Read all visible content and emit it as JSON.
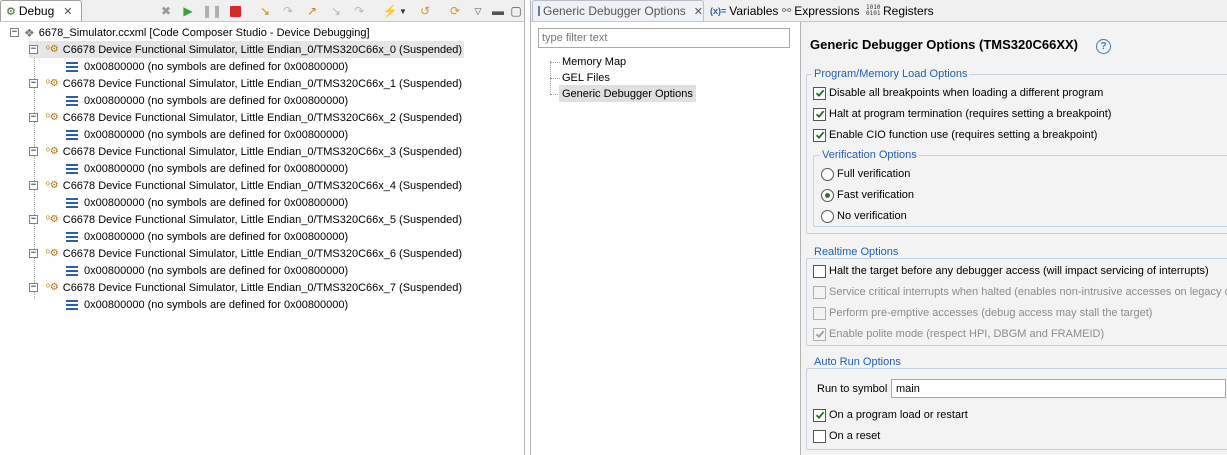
{
  "debug_view": {
    "tab_label": "Debug",
    "root_label": "6678_Simulator.ccxml [Code Composer Studio - Device Debugging]",
    "threads": [
      {
        "label": "C6678 Device Functional Simulator, Little Endian_0/TMS320C66x_0 (Suspended)",
        "frame": "0x00800000  (no symbols are defined for 0x00800000)"
      },
      {
        "label": "C6678 Device Functional Simulator, Little Endian_0/TMS320C66x_1 (Suspended)",
        "frame": "0x00800000  (no symbols are defined for 0x00800000)"
      },
      {
        "label": "C6678 Device Functional Simulator, Little Endian_0/TMS320C66x_2 (Suspended)",
        "frame": "0x00800000  (no symbols are defined for 0x00800000)"
      },
      {
        "label": "C6678 Device Functional Simulator, Little Endian_0/TMS320C66x_3 (Suspended)",
        "frame": "0x00800000  (no symbols are defined for 0x00800000)"
      },
      {
        "label": "C6678 Device Functional Simulator, Little Endian_0/TMS320C66x_4 (Suspended)",
        "frame": "0x00800000  (no symbols are defined for 0x00800000)"
      },
      {
        "label": "C6678 Device Functional Simulator, Little Endian_0/TMS320C66x_5 (Suspended)",
        "frame": "0x00800000  (no symbols are defined for 0x00800000)"
      },
      {
        "label": "C6678 Device Functional Simulator, Little Endian_0/TMS320C66x_6 (Suspended)",
        "frame": "0x00800000  (no symbols are defined for 0x00800000)"
      },
      {
        "label": "C6678 Device Functional Simulator, Little Endian_0/TMS320C66x_7 (Suspended)",
        "frame": "0x00800000  (no symbols are defined for 0x00800000)"
      }
    ]
  },
  "tabs": {
    "gdo": "Generic Debugger Options",
    "variables": "Variables",
    "expressions": "Expressions",
    "registers": "Registers"
  },
  "nav": {
    "filter_placeholder": "type filter text",
    "items": [
      "Memory Map",
      "GEL Files",
      "Generic Debugger Options"
    ]
  },
  "options": {
    "title": "Generic Debugger Options (TMS320C66XX)",
    "help_icon": "?",
    "program_group": "Program/Memory Load Options",
    "program_items": [
      {
        "label": "Disable all breakpoints when loading a different program",
        "checked": true
      },
      {
        "label": "Halt at program termination (requires setting a breakpoint)",
        "checked": true
      },
      {
        "label": "Enable CIO function use (requires setting a breakpoint)",
        "checked": true
      }
    ],
    "verification_group": "Verification Options",
    "verification_items": [
      {
        "label": "Full verification",
        "selected": false
      },
      {
        "label": "Fast verification",
        "selected": true
      },
      {
        "label": "No verification",
        "selected": false
      }
    ],
    "realtime_group": "Realtime Options",
    "realtime_items": [
      {
        "label": "Halt the target before any debugger access (will impact servicing of interrupts)",
        "checked": false,
        "enabled": true
      },
      {
        "label": "Service critical interrupts when halted (enables non-intrusive accesses on legacy de",
        "checked": false,
        "enabled": false
      },
      {
        "label": "Perform pre-emptive accesses (debug access may stall the target)",
        "checked": false,
        "enabled": false
      },
      {
        "label": "Enable polite mode (respect HPI, DBGM and FRAMEID)",
        "checked": true,
        "enabled": false
      }
    ],
    "autorun_group": "Auto Run Options",
    "run_to_label": "Run to symbol",
    "run_to_value": "main",
    "autorun_items": [
      {
        "label": "On a program load or restart",
        "checked": true
      },
      {
        "label": "On a reset",
        "checked": false
      }
    ]
  },
  "colors": {
    "group_title": "#1f5fb5",
    "selection": "#e0e0e0",
    "check": "#1a6a1a"
  }
}
